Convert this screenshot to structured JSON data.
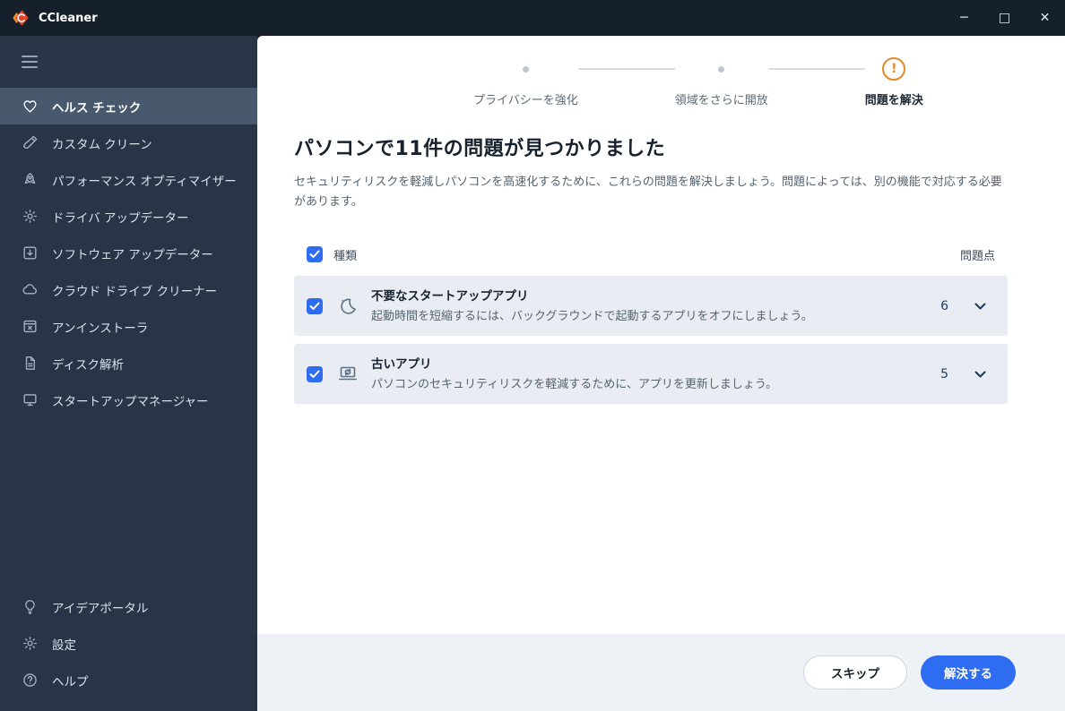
{
  "window": {
    "title": "CCleaner",
    "controls": {
      "minimize": "─",
      "maximize": "□",
      "close": "✕"
    }
  },
  "sidebar": {
    "items": [
      {
        "label": "ヘルス チェック",
        "icon": "heart-icon",
        "active": true
      },
      {
        "label": "カスタム クリーン",
        "icon": "brush-icon",
        "active": false
      },
      {
        "label": "パフォーマンス オプティマイザー",
        "icon": "rocket-icon",
        "active": false
      },
      {
        "label": "ドライバ アップデーター",
        "icon": "driver-gear-icon",
        "active": false
      },
      {
        "label": "ソフトウェア アップデーター",
        "icon": "software-update-icon",
        "active": false
      },
      {
        "label": "クラウド ドライブ クリーナー",
        "icon": "cloud-icon",
        "active": false
      },
      {
        "label": "アンインストーラ",
        "icon": "uninstaller-icon",
        "active": false
      },
      {
        "label": "ディスク解析",
        "icon": "disk-analyzer-icon",
        "active": false
      },
      {
        "label": "スタートアップマネージャー",
        "icon": "monitor-icon",
        "active": false
      }
    ],
    "bottom_items": [
      {
        "label": "アイデアポータル",
        "icon": "lightbulb-icon"
      },
      {
        "label": "設定",
        "icon": "gear-icon"
      },
      {
        "label": "ヘルプ",
        "icon": "help-icon"
      }
    ]
  },
  "stepper": {
    "steps": [
      {
        "label": "プライバシーを強化",
        "state": "past"
      },
      {
        "label": "領域をさらに開放",
        "state": "past"
      },
      {
        "label": "問題を解決",
        "state": "current"
      }
    ],
    "current_icon_glyph": "!"
  },
  "main": {
    "title": "パソコンで11件の問題が見つかりました",
    "subtitle": "セキュリティリスクを軽減しパソコンを高速化するために、これらの問題を解決しましょう。問題によっては、別の機能で対応する必要があります。",
    "issues_table": {
      "type_header": "種類",
      "score_header": "問題点",
      "select_all_checked": true,
      "rows": [
        {
          "checked": true,
          "icon": "moon-icon",
          "title": "不要なスタートアップアプリ",
          "description": "起動時間を短縮するには、バックグラウンドで起動するアプリをオフにしましょう。",
          "score": "6"
        },
        {
          "checked": true,
          "icon": "old-apps-icon",
          "title": "古いアプリ",
          "description": "パソコンのセキュリティリスクを軽減するために、アプリを更新しましょう。",
          "score": "5"
        }
      ]
    },
    "footer": {
      "skip_label": "スキップ",
      "solve_label": "解決する"
    }
  },
  "colors": {
    "accent_blue": "#2e6cf1",
    "warning_orange": "#e2892b",
    "titlebar_bg": "#15202b",
    "sidebar_bg": "#273547",
    "sidebar_active_bg": "#48596d",
    "row_bg": "#e9edf3",
    "footer_bg": "#eef1f6"
  }
}
